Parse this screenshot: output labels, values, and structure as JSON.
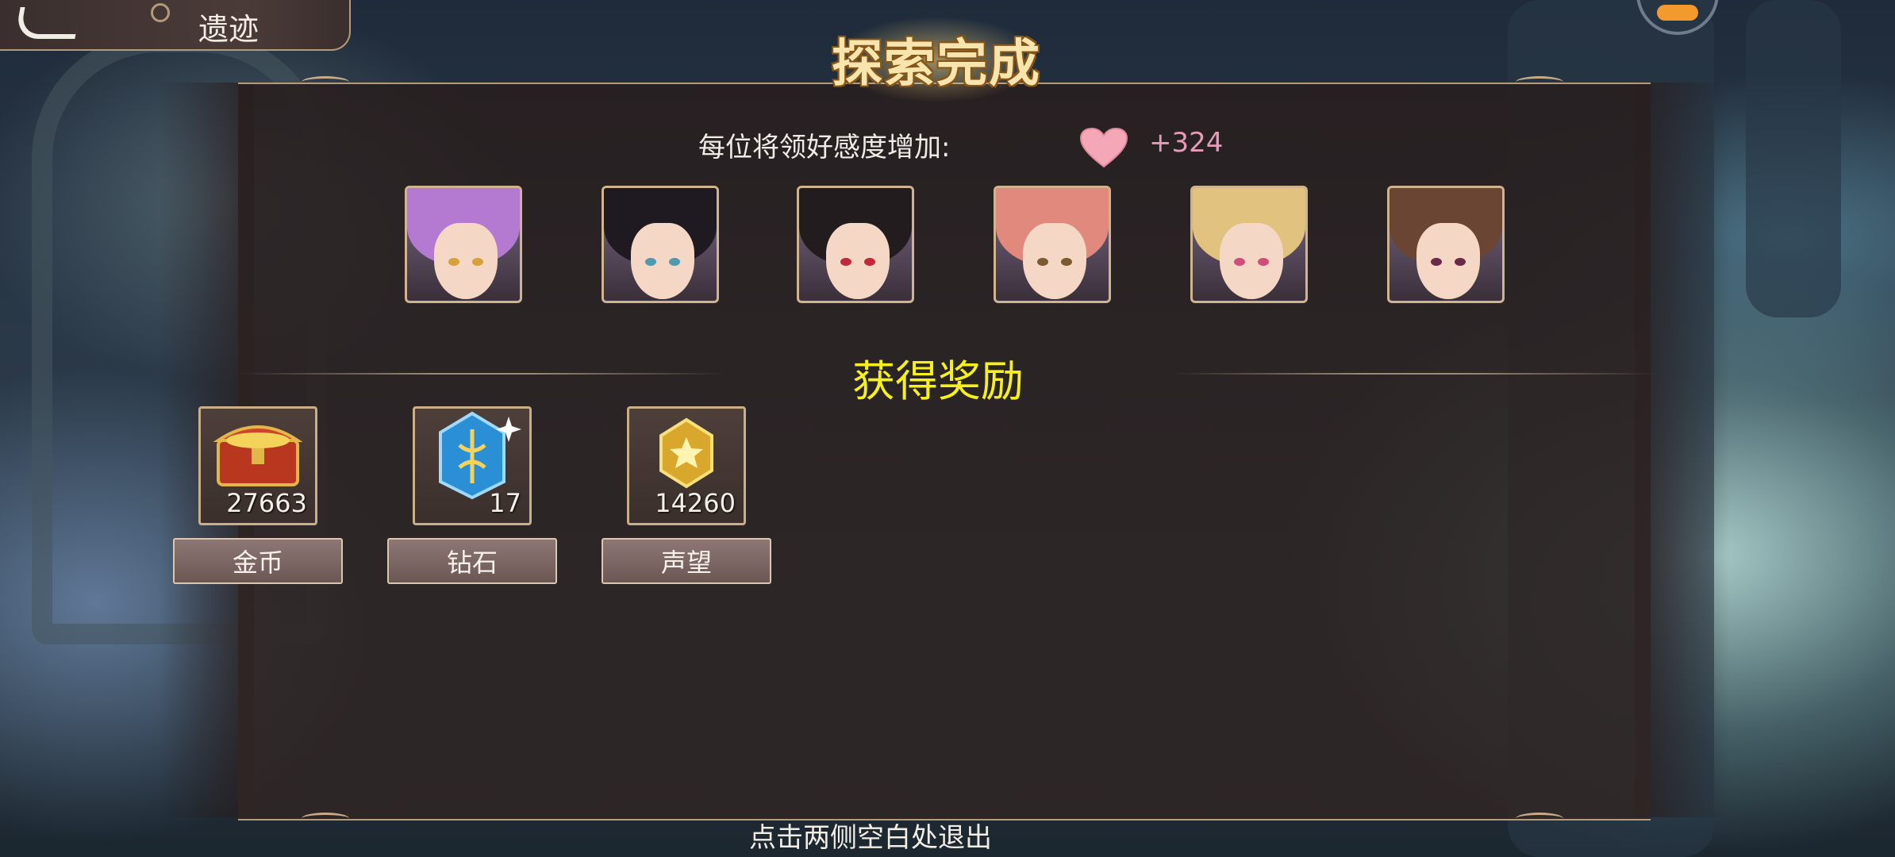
{
  "header": {
    "title": "遗迹"
  },
  "result": {
    "title": "探索完成",
    "affinity_label": "每位将领好感度增加:",
    "affinity_value": "+324"
  },
  "portraits": [
    {
      "name": "portrait-1",
      "hair": "#b47ad2",
      "eye": "#d8a03a"
    },
    {
      "name": "portrait-2",
      "hair": "#1f1a22",
      "eye": "#4f9ab0"
    },
    {
      "name": "portrait-3",
      "hair": "#231c1e",
      "eye": "#c2283a"
    },
    {
      "name": "portrait-4",
      "hair": "#e2897d",
      "eye": "#7a5a2e"
    },
    {
      "name": "portrait-5",
      "hair": "#e1c27f",
      "eye": "#d04e7a"
    },
    {
      "name": "portrait-6",
      "hair": "#6a4534",
      "eye": "#6a2a4a"
    }
  ],
  "rewards": {
    "title": "获得奖励",
    "items": [
      {
        "label": "金币",
        "count": "27663",
        "icon": "treasure-chest-icon"
      },
      {
        "label": "钻石",
        "count": "17",
        "icon": "diamond-crystal-icon"
      },
      {
        "label": "声望",
        "count": "14260",
        "icon": "prestige-medal-icon"
      }
    ]
  },
  "footer": {
    "exit_hint": "点击两侧空白处退出"
  }
}
